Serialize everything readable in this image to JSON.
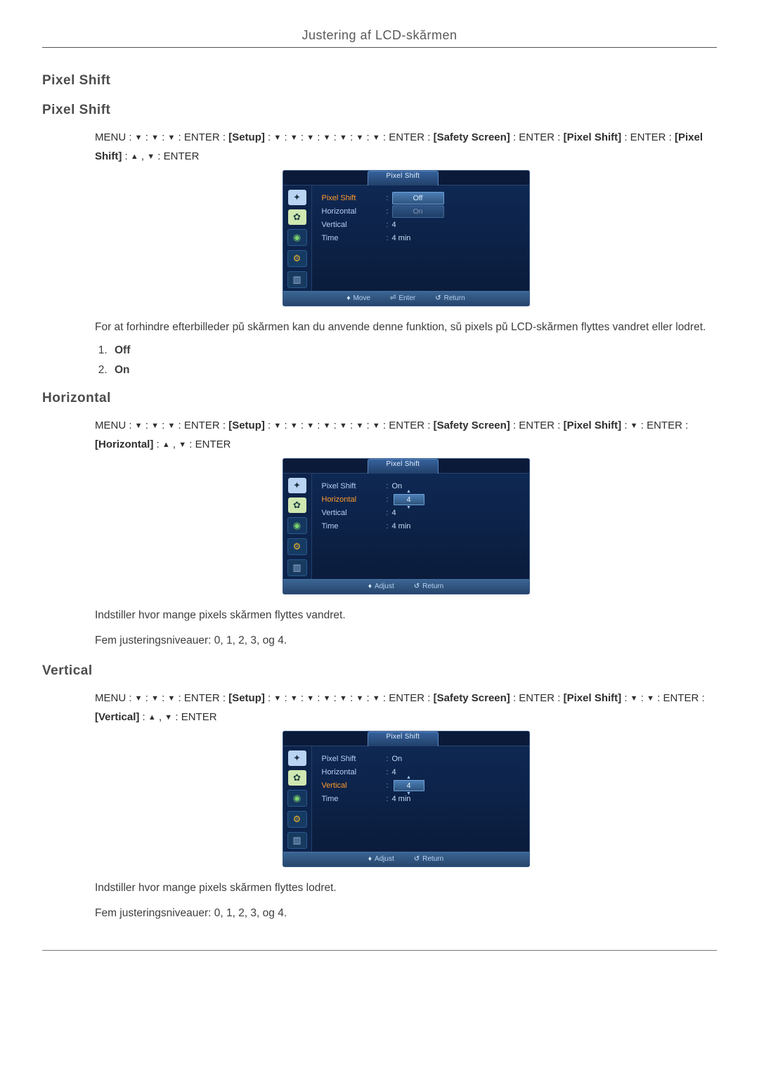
{
  "header": {
    "title": "Justering af LCD-skărmen"
  },
  "sections": {
    "pixel_shift": {
      "h2": "Pixel Shift",
      "h3": "Pixel Shift",
      "nav_tokens": [
        "MENU",
        ":",
        "▼",
        ":",
        "▼",
        ":",
        "▼",
        ":",
        "ENTER",
        ":",
        "[Setup]",
        ":",
        "▼",
        ":",
        "▼",
        ":",
        "▼",
        ":",
        "▼",
        ":",
        "▼",
        ":",
        "▼",
        ":",
        "▼",
        ":",
        "ENTER",
        ":",
        "[Safety Screen]",
        ":",
        "ENTER",
        ":",
        "[Pixel Shift]",
        ":",
        "ENTER",
        ":",
        "[Pixel Shift]",
        ":",
        "▲",
        ",",
        "▼",
        ":",
        "ENTER"
      ],
      "body": "For at forhindre efterbilleder pŭ skărmen kan du anvende denne funktion, sŭ pixels pŭ LCD-skărmen flyttes vandret eller lodret.",
      "options": {
        "1": "Off",
        "2": "On"
      },
      "osd": {
        "tab": "Pixel Shift",
        "rows": {
          "pixel_shift": {
            "label": "Pixel Shift",
            "value": "Off",
            "highlight_label": true,
            "pill_hl": true
          },
          "horizontal": {
            "label": "Horizontal",
            "value": "On",
            "pill_dim": true
          },
          "vertical": {
            "label": "Vertical",
            "value": "4"
          },
          "time": {
            "label": "Time",
            "value": "4 min"
          }
        },
        "footer": {
          "move": "Move",
          "enter": "Enter",
          "return": "Return"
        }
      }
    },
    "horizontal": {
      "h3": "Horizontal",
      "nav_tokens": [
        "MENU",
        ":",
        "▼",
        ":",
        "▼",
        ":",
        "▼",
        ":",
        "ENTER",
        ":",
        "[Setup]",
        ":",
        "▼",
        ":",
        "▼",
        ":",
        "▼",
        ":",
        "▼",
        ":",
        "▼",
        ":",
        "▼",
        ":",
        "▼",
        ":",
        "ENTER",
        ":",
        "[Safety Screen]",
        ":",
        "ENTER",
        ":",
        "[Pixel Shift]",
        ":",
        "▼",
        ":",
        "ENTER",
        ":",
        "[Horizontal]",
        ":",
        "▲",
        ",",
        "▼",
        ":",
        "ENTER"
      ],
      "body1": "Indstiller hvor mange pixels skărmen flyttes vandret.",
      "body2": "Fem justeringsniveauer: 0, 1, 2, 3, og 4.",
      "osd": {
        "tab": "Pixel Shift",
        "rows": {
          "pixel_shift": {
            "label": "Pixel Shift",
            "value": "On"
          },
          "horizontal": {
            "label": "Horizontal",
            "spin": "4",
            "highlight_label": true
          },
          "vertical": {
            "label": "Vertical",
            "value": "4"
          },
          "time": {
            "label": "Time",
            "value": "4 min"
          }
        },
        "footer": {
          "adjust": "Adjust",
          "return": "Return"
        }
      }
    },
    "vertical": {
      "h3": "Vertical",
      "nav_tokens": [
        "MENU",
        ":",
        "▼",
        ":",
        "▼",
        ":",
        "▼",
        ":",
        "ENTER",
        ":",
        "[Setup]",
        ":",
        "▼",
        ":",
        "▼",
        ":",
        "▼",
        ":",
        "▼",
        ":",
        "▼",
        ":",
        "▼",
        ":",
        "▼",
        ":",
        "ENTER",
        ":",
        "[Safety Screen]",
        ":",
        "ENTER",
        ":",
        "[Pixel Shift]",
        ":",
        "▼",
        ":",
        "▼",
        ":",
        "ENTER",
        ":",
        "[Vertical]",
        ":",
        "▲",
        ",",
        "▼",
        ":",
        "ENTER"
      ],
      "body1": "Indstiller hvor mange pixels skărmen flyttes lodret.",
      "body2": "Fem justeringsniveauer: 0, 1, 2, 3, og 4.",
      "osd": {
        "tab": "Pixel Shift",
        "rows": {
          "pixel_shift": {
            "label": "Pixel Shift",
            "value": "On"
          },
          "horizontal": {
            "label": "Horizontal",
            "value": "4"
          },
          "vertical": {
            "label": "Vertical",
            "spin": "4",
            "highlight_label": true
          },
          "time": {
            "label": "Time",
            "value": "4 min"
          }
        },
        "footer": {
          "adjust": "Adjust",
          "return": "Return"
        }
      }
    }
  }
}
